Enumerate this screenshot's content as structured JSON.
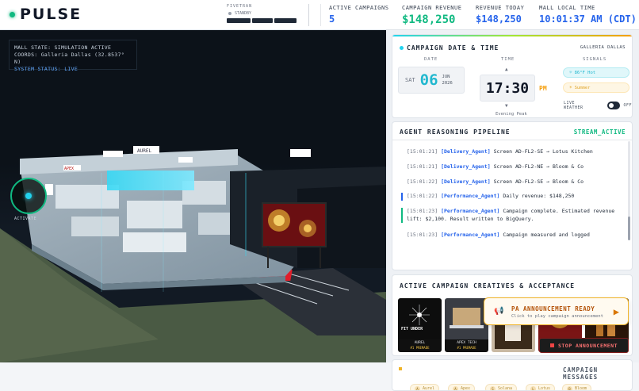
{
  "header": {
    "brand": "PULSE",
    "fivetran_label": "FIVETRAN",
    "fivetran_state": "STANDBY",
    "active_campaigns_label": "ACTIVE CAMPAIGNS",
    "active_campaigns_value": "5",
    "campaign_revenue_label": "CAMPAIGN REVENUE",
    "campaign_revenue_value": "$148,250",
    "revenue_today_label": "REVENUE TODAY",
    "revenue_today_value": "$148,250",
    "mall_time_label": "MALL LOCAL TIME",
    "mall_time_value": "10:01:37 AM (CDT)"
  },
  "scene": {
    "mall_state": "MALL STATE: SIMULATION ACTIVE",
    "coords": "COORDS: Galleria Dallas (32.8537° N)",
    "system_status": "SYSTEM STATUS: LIVE",
    "activate_label": "ACTIVATE",
    "sign_aurel": "AUREL",
    "sign_apex": "APEX"
  },
  "datetime": {
    "title": "CAMPAIGN DATE & TIME",
    "location": "GALLERIA DALLAS",
    "date_label": "DATE",
    "time_label": "TIME",
    "signals_label": "SIGNALS",
    "dow": "SAT",
    "day": "06",
    "month": "JUN",
    "year": "2026",
    "time": "17:30",
    "ampm": "PM",
    "period": "Evening Peak",
    "signal_hot": "86°F Hot",
    "signal_summer": "Summer",
    "live_weather": "LIVE WEATHER",
    "live_weather_state": "OFF"
  },
  "pipeline": {
    "title": "AGENT REASONING PIPELINE",
    "status": "STREAM_ACTIVE",
    "logs": [
      {
        "ts": "[15:01:21]",
        "agent": "[Delivery_Agent]",
        "msg": " Screen AD-FL2-SE → Lotus Kitchen"
      },
      {
        "ts": "[15:01:21]",
        "agent": "[Delivery_Agent]",
        "msg": " Screen AD-FL2-NE → Bloom & Co"
      },
      {
        "ts": "[15:01:22]",
        "agent": "[Delivery_Agent]",
        "msg": " Screen AD-FL2-SE → Bloom & Co"
      },
      {
        "ts": "[15:01:22]",
        "agent": "[Performance_Agent]",
        "msg": " Daily revenue: $148,250"
      },
      {
        "ts": "[15:01:23]",
        "agent": "[Performance_Agent]",
        "msg": " Campaign complete. Estimated revenue lift: $2,100. Result written to BigQuery."
      },
      {
        "ts": "[15:01:23]",
        "agent": "[Performance_Agent]",
        "msg": " Campaign measured and logged"
      }
    ]
  },
  "creatives": {
    "title": "ACTIVE CAMPAIGN CREATIVES & ACCEPTANCE",
    "items": [
      {
        "name": "AUREL",
        "tag": "#1 PREMADE",
        "img_text": "FIT UNDER",
        "bg": "#0d0d0d"
      },
      {
        "name": "APEX TECH",
        "tag": "#1 PREMADE",
        "img_text": "",
        "bg": "#3a3d44"
      },
      {
        "name": "",
        "tag": "",
        "img_text": "",
        "bg": "#c9b9a3"
      },
      {
        "name": "",
        "tag": "",
        "img_text": "",
        "bg": "#7a1515"
      },
      {
        "name": "",
        "tag": "",
        "img_text": "",
        "bg": "#2a1508"
      }
    ]
  },
  "announcement": {
    "title": "PA ANNOUNCEMENT READY",
    "subtitle": "Click to play campaign announcement",
    "stop_label": "STOP ANNOUNCEMENT"
  },
  "messages": {
    "title": "CAMPAIGN MESSAGES",
    "chips": [
      {
        "n": "A",
        "label": "Aurel"
      },
      {
        "n": "A",
        "label": "Apex"
      },
      {
        "n": "S",
        "label": "Solana"
      },
      {
        "n": "L",
        "label": "Lotus"
      },
      {
        "n": "B",
        "label": "Bloom"
      }
    ]
  },
  "colors": {
    "accent_green": "#10b981",
    "accent_blue": "#2563eb",
    "accent_cyan": "#22d3ee",
    "accent_amber": "#f0b429"
  }
}
